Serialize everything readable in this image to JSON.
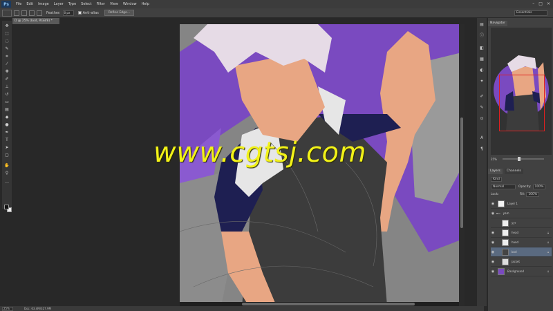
{
  "menubar": {
    "logo": "Ps",
    "items": [
      "File",
      "Edit",
      "Image",
      "Layer",
      "Type",
      "Select",
      "Filter",
      "View",
      "Window",
      "Help"
    ]
  },
  "options": {
    "feather_label": "Feather:",
    "feather_value": "0 px",
    "antialias_label": "Anti-alias",
    "refine_label": "Refine Edge...",
    "workspace": "Essentials"
  },
  "document": {
    "tab_title": "D @ 25% (bod, RGB/8) *",
    "zoom": "25%",
    "doc_size": "Doc: 63.4M/327.9M"
  },
  "navigator": {
    "tab": "Navigator",
    "zoom": "25%"
  },
  "layers": {
    "tabs": [
      "Layers",
      "Channels"
    ],
    "filter_kind": "Kind",
    "blend_mode": "Normal",
    "opacity_label": "Opacity:",
    "opacity_value": "100%",
    "lock_label": "Lock:",
    "fill_label": "Fill:",
    "fill_value": "100%",
    "items": [
      {
        "name": "Layer 1",
        "selected": false
      },
      {
        "name": "yam",
        "selected": false
      },
      {
        "name": "yyr",
        "selected": false
      },
      {
        "name": "head",
        "selected": false
      },
      {
        "name": "hand",
        "selected": false
      },
      {
        "name": "bod",
        "selected": true
      },
      {
        "name": "jacket",
        "selected": false
      },
      {
        "name": "Background",
        "selected": false
      }
    ]
  },
  "watermark": "www.cgtsj.com",
  "colors": {
    "skin": "#e8a683",
    "jacket": "#1e1f52",
    "shirt": "#3c3c3c",
    "purple_bg": "#7a4ac0",
    "hair": "#e6dbe6",
    "watermark": "#f2f218"
  }
}
